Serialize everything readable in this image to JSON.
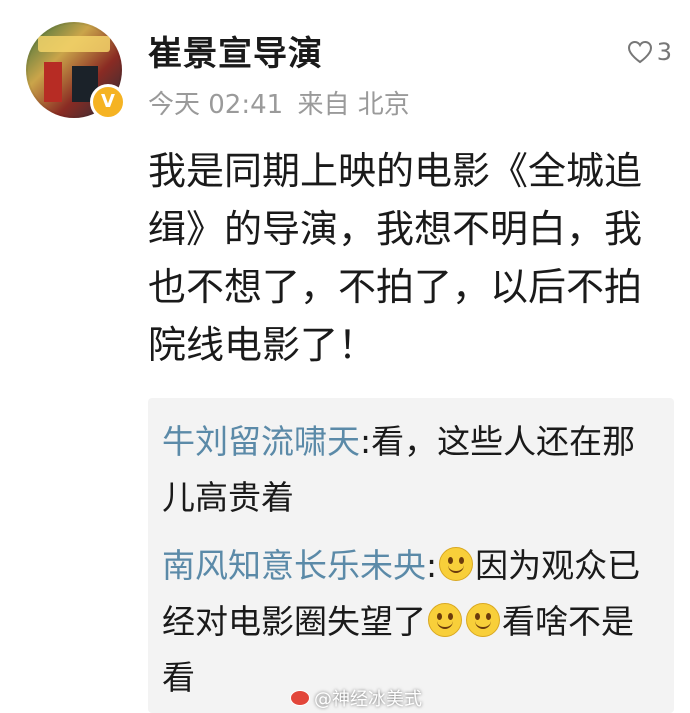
{
  "post": {
    "author": "崔景宣导演",
    "time": "今天 02:41",
    "source": "来自 北京",
    "like_count": "3",
    "content": "我是同期上映的电影《全城追缉》的导演，我想不明白，我也不想了，不拍了，以后不拍院线电影了！"
  },
  "comments": [
    {
      "name": "牛刘留流啸天",
      "separator": ":",
      "text": "看，这些人还在那儿高贵着"
    },
    {
      "name": "南风知意长乐未央",
      "separator": ":",
      "text_before": "因为观众已经对电影圈失望了",
      "text_after": "看啥不是看"
    }
  ],
  "watermark": "@神经冰美式",
  "colors": {
    "commenter": "#5b8aa8",
    "meta": "#9a9a9a",
    "badge": "#f5b323",
    "comment_bg": "#f3f3f3"
  },
  "icons": {
    "like": "heart-outline-icon",
    "verified": "verified-v-badge-icon",
    "emoji": "smiley-emoji-icon"
  }
}
